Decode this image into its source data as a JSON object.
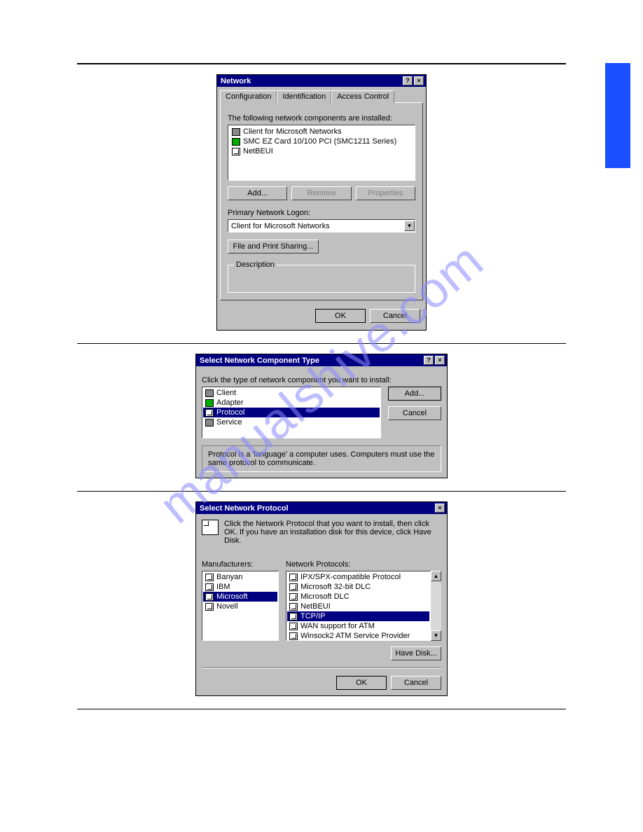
{
  "watermark": "manualshive.com",
  "dialogs": {
    "network": {
      "title": "Network",
      "help_btn": "?",
      "close_btn": "×",
      "tabs": [
        "Configuration",
        "Identification",
        "Access Control"
      ],
      "components_label": "The following network components are installed:",
      "components": [
        "Client for Microsoft Networks",
        "SMC EZ Card 10/100 PCI (SMC1211 Series)",
        "NetBEUI"
      ],
      "btn_add": "Add...",
      "btn_remove": "Remove",
      "btn_properties": "Properties",
      "logon_label": "Primary Network Logon:",
      "logon_value": "Client for Microsoft Networks",
      "btn_fileshare": "File and Print Sharing...",
      "desc_legend": "Description",
      "btn_ok": "OK",
      "btn_cancel": "Cancel"
    },
    "componentType": {
      "title": "Select Network Component Type",
      "help_btn": "?",
      "close_btn": "×",
      "prompt": "Click the type of network component you want to install:",
      "items": [
        "Client",
        "Adapter",
        "Protocol",
        "Service"
      ],
      "selected_index": 2,
      "btn_add": "Add...",
      "btn_cancel": "Cancel",
      "hint": "Protocol is a 'language' a computer uses. Computers must use the same protocol to communicate."
    },
    "protocol": {
      "title": "Select Network Protocol",
      "close_btn": "×",
      "instruction": "Click the Network Protocol that you want to install, then click OK. If you have an installation disk for this device, click Have Disk.",
      "manu_label": "Manufacturers:",
      "manufacturers": [
        "Banyan",
        "IBM",
        "Microsoft",
        "Novell"
      ],
      "manu_selected_index": 2,
      "proto_label": "Network Protocols:",
      "protocols": [
        "IPX/SPX-compatible Protocol",
        "Microsoft 32-bit DLC",
        "Microsoft DLC",
        "NetBEUI",
        "TCP/IP",
        "WAN support for ATM",
        "Winsock2 ATM Service Provider"
      ],
      "proto_selected_index": 4,
      "btn_havedisk": "Have Disk...",
      "btn_ok": "OK",
      "btn_cancel": "Cancel"
    }
  }
}
